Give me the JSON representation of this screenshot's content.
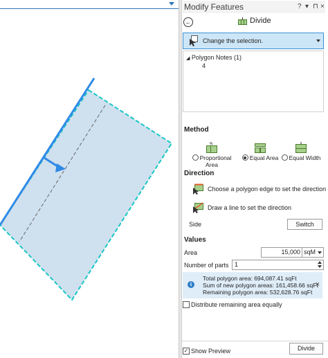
{
  "pane": {
    "title": "Modify Features",
    "controls": {
      "help": "?",
      "dropdown": "▾",
      "pin": "⊓",
      "close": "×"
    },
    "back_icon": "←",
    "tool_name": "Divide"
  },
  "selection": {
    "button_label": "Change the selection.",
    "tree": {
      "layer": "Polygon Notes (1)",
      "feature": "4"
    }
  },
  "method": {
    "heading": "Method",
    "options": [
      {
        "label": "Proportional Area",
        "selected": false
      },
      {
        "label": "Equal Area",
        "selected": true
      },
      {
        "label": "Equal Width",
        "selected": false
      }
    ]
  },
  "direction": {
    "heading": "Direction",
    "edge_label": "Choose a polygon edge to set the direction",
    "line_label": "Draw a line to set the direction",
    "side_label": "Side",
    "switch_label": "Switch"
  },
  "values": {
    "heading": "Values",
    "area_label": "Area",
    "area_value": "15,000",
    "area_unit": "sqM",
    "parts_label": "Number of parts",
    "parts_value": "1"
  },
  "info": {
    "icon": "i",
    "close": "×",
    "total": "Total polygon area: 694,087.41 sqFt",
    "sum_new": "Sum of new polygon areas: 161,458.66 sqFt",
    "remaining": "Remaining polygon area: 532,628.76 sqFt"
  },
  "distribute": {
    "label": "Distribute remaining area equally",
    "checked": false
  },
  "footer": {
    "preview_label": "Show Preview",
    "preview_checked": true,
    "divide_label": "Divide"
  },
  "colors": {
    "accent": "#3c8fd3",
    "polygon_fill": "#cfe0ee",
    "polygon_edge": "#19c6c6",
    "selected_edge": "#2f8ae6"
  }
}
